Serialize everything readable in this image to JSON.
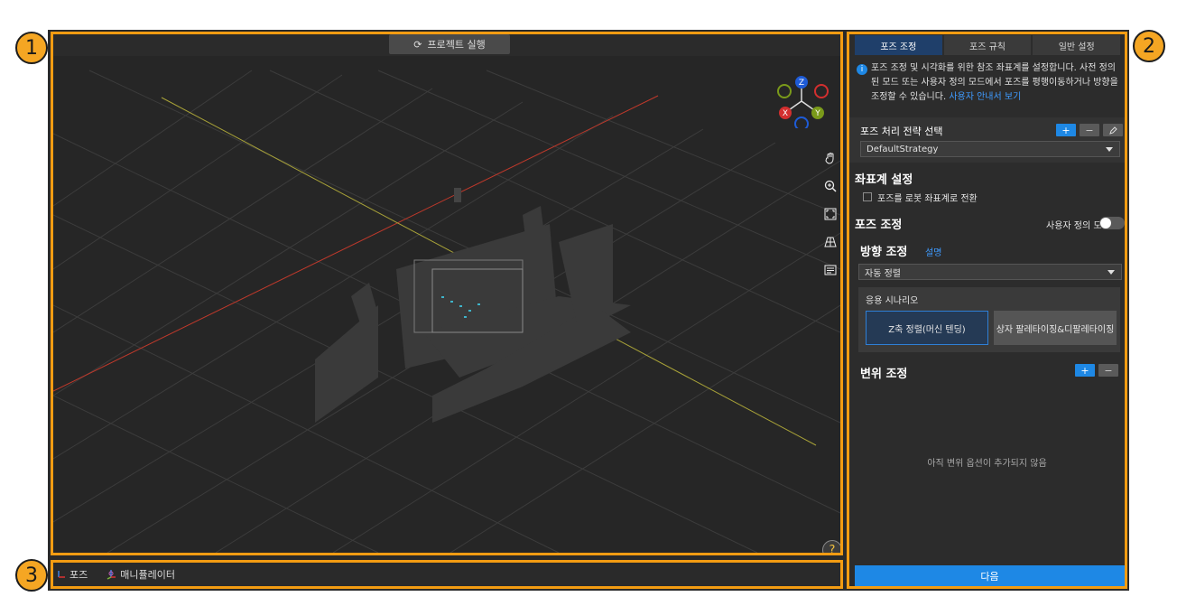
{
  "callouts": [
    "1",
    "2",
    "3"
  ],
  "viewport": {
    "run_button_label": "프로젝트 실행",
    "run_icon": "refresh-icon",
    "axes": {
      "z": "Z",
      "x": "X",
      "y": "Y"
    },
    "tools": [
      "hand-pan-icon",
      "zoom-in-icon",
      "fit-view-icon",
      "perspective-grid-icon",
      "display-settings-icon"
    ],
    "help_label": "?"
  },
  "bottom_bar": {
    "items": [
      {
        "label": "포즈",
        "icon": "pose-axis-icon"
      },
      {
        "label": "매니퓰레이터",
        "icon": "manipulator-icon"
      }
    ]
  },
  "panel": {
    "steps": [
      {
        "label": "포즈 조정",
        "active": true
      },
      {
        "label": "포즈 규칙",
        "active": false
      },
      {
        "label": "일반 설정",
        "active": false
      }
    ],
    "info_text": "포즈 조정 및 시각화를 위한 참조 좌표계를 설정합니다. 사전 정의된 모드 또는 사용자 정의 모드에서 포즈를 평행이동하거나 방향을 조정할 수 있습니다.",
    "info_link": "사용자 안내서 보기",
    "strategy": {
      "title": "포즈 처리 전략 선택",
      "add": "+",
      "remove": "−",
      "selected": "DefaultStrategy"
    },
    "coord": {
      "title": "좌표계 설정",
      "checkbox_label": "포즈를 로봇 좌표계로 전환"
    },
    "pose_adjust": {
      "title": "포즈 조정",
      "custom_mode_label": "사용자 정의 모드"
    },
    "orientation": {
      "title": "방향 조정",
      "help_link": "설명",
      "selected": "자동 정렬",
      "scenario_title": "응용 시나리오",
      "scenarios": [
        "Z축 정렬(머신 텐딩)",
        "상자 팔레타이징&디팔레타이징"
      ]
    },
    "translation": {
      "title": "변위 조정",
      "add": "+",
      "remove": "−",
      "empty_text": "아직 변위 옵션이 추가되지 않음"
    },
    "next_button": "다음"
  },
  "colors": {
    "accent_orange": "#f39c12",
    "primary_blue": "#1e88e5",
    "axis_red": "#d32f2f",
    "axis_yellow": "#b9b13a"
  }
}
